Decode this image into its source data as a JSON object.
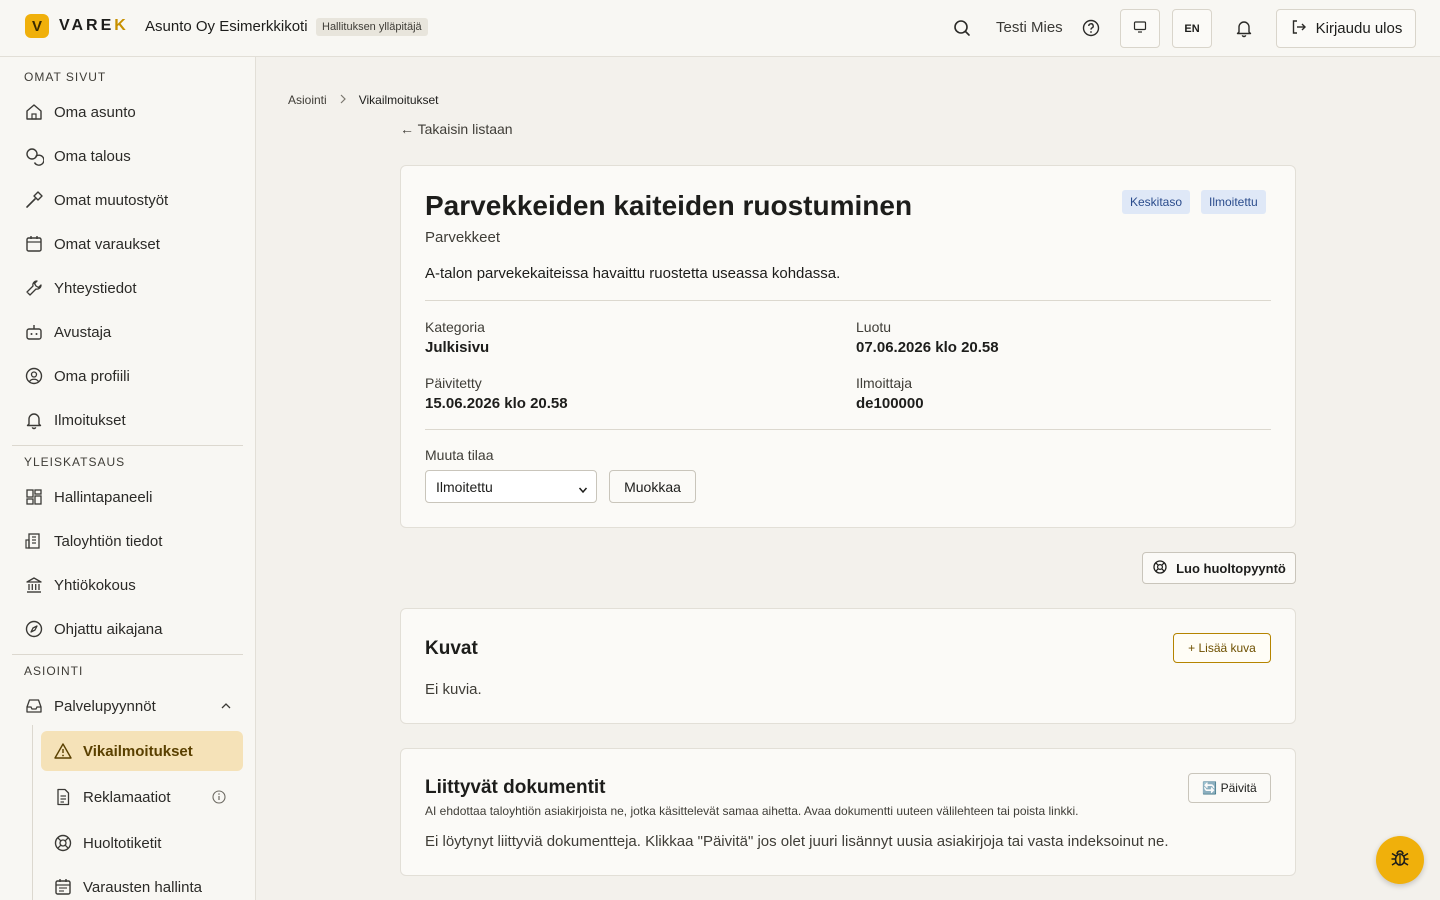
{
  "header": {
    "logo_letter": "V",
    "logo_text_a": "VARE",
    "logo_text_b": "K",
    "org_name": "Asunto Oy Esimerkkikoti",
    "role_badge": "Hallituksen ylläpitäjä",
    "user_name": "Testi Mies",
    "lang_label": "EN",
    "logout_label": "Kirjaudu ulos"
  },
  "sidebar": {
    "sections": [
      {
        "title": "OMAT SIVUT"
      },
      {
        "title": "YLEISKATSAUS"
      },
      {
        "title": "ASIOINTI"
      }
    ],
    "personal": [
      {
        "label": "Oma asunto",
        "icon": "home-icon"
      },
      {
        "label": "Oma talous",
        "icon": "coins-icon"
      },
      {
        "label": "Omat muutostyöt",
        "icon": "hammer-icon"
      },
      {
        "label": "Omat varaukset",
        "icon": "calendar-icon"
      },
      {
        "label": "Yhteystiedot",
        "icon": "wrench-icon"
      },
      {
        "label": "Avustaja",
        "icon": "bot-icon"
      },
      {
        "label": "Oma profiili",
        "icon": "user-circle-icon"
      },
      {
        "label": "Ilmoitukset",
        "icon": "bell-icon"
      }
    ],
    "overview": [
      {
        "label": "Hallintapaneeli",
        "icon": "dashboard-icon"
      },
      {
        "label": "Taloyhtiön tiedot",
        "icon": "building-icon"
      },
      {
        "label": "Yhtiökokous",
        "icon": "landmark-icon"
      },
      {
        "label": "Ohjattu aikajana",
        "icon": "compass-icon"
      }
    ],
    "services": {
      "group_label": "Palvelupyynnöt",
      "items": [
        {
          "label": "Vikailmoitukset",
          "icon": "warning-icon",
          "active": true
        },
        {
          "label": "Reklamaatiot",
          "icon": "document-icon"
        },
        {
          "label": "Huoltotiketit",
          "icon": "lifebuoy-icon"
        },
        {
          "label": "Varausten hallinta",
          "icon": "calendar-icon"
        }
      ]
    }
  },
  "breadcrumb": {
    "parent": "Asiointi",
    "current": "Vikailmoitukset"
  },
  "back_link": "← Takaisin listaan",
  "issue": {
    "title": "Parvekkeiden kaiteiden ruostuminen",
    "subtitle": "Parvekkeet",
    "tags": [
      "Keskitaso",
      "Ilmoitettu"
    ],
    "description": "A-talon parvekekaiteissa havaittu ruostetta useassa kohdassa.",
    "fields": {
      "category_label": "Kategoria",
      "category_value": "Julkisivu",
      "created_label": "Luotu",
      "created_value": "07.06.2026 klo 20.58",
      "updated_label": "Päivitetty",
      "updated_value": "15.06.2026 klo 20.58",
      "reporter_label": "Ilmoittaja",
      "reporter_value": "de100000"
    },
    "status_label": "Muuta tilaa",
    "status_value": "Ilmoitettu",
    "edit_label": "Muokkaa"
  },
  "service_request_label": "Luo huoltopyyntö",
  "images": {
    "title": "Kuvat",
    "add_label": "+ Lisää kuva",
    "empty": "Ei kuvia."
  },
  "documents": {
    "title": "Liittyvät dokumentit",
    "hint": "AI ehdottaa taloyhtiön asiakirjoista ne, jotka käsittelevät samaa aihetta. Avaa dokumentti uuteen välilehteen tai poista linkki.",
    "refresh_label": "🔄 Päivitä",
    "empty": "Ei löytynyt liittyviä dokumentteja. Klikkaa \"Päivitä\" jos olet juuri lisännyt uusia asiakirjoja tai vasta indeksoinut ne."
  },
  "colors": {
    "accent": "#f0b00b",
    "active_bg": "#f5e2b8",
    "tag_bg": "#dfe8f7"
  }
}
